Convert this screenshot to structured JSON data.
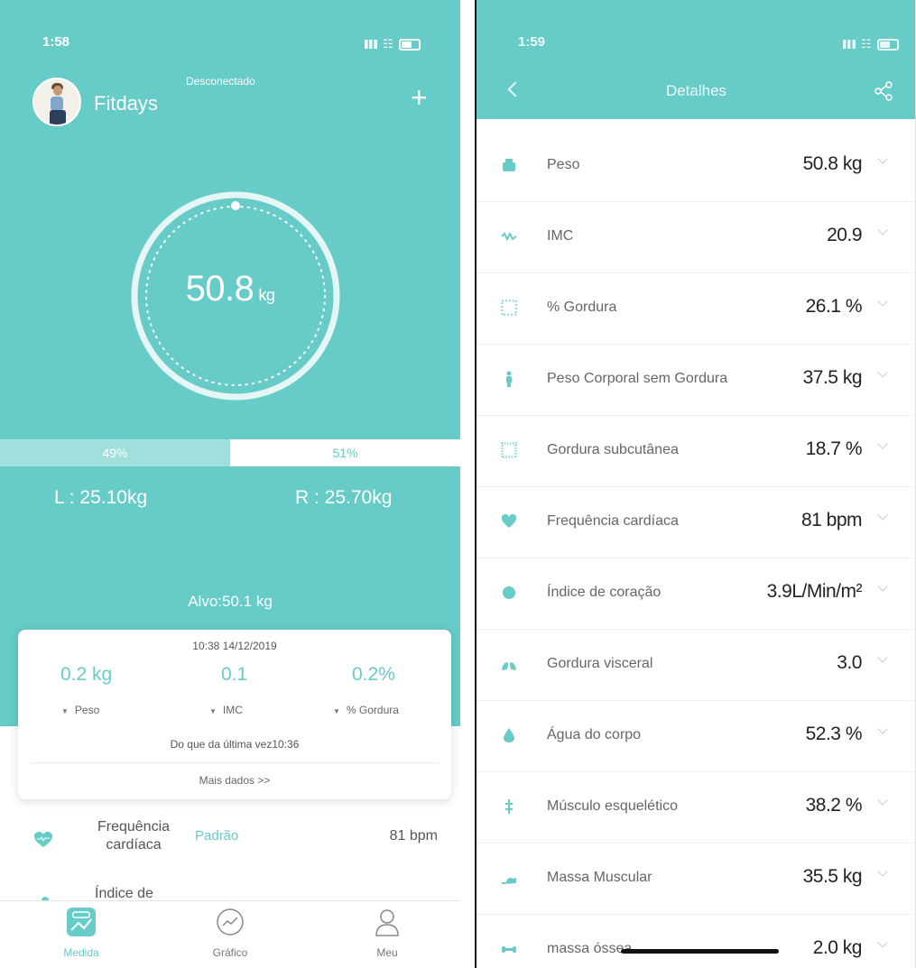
{
  "left": {
    "status_time": "1:58",
    "user_name": "Fitdays",
    "connection": "Desconectado",
    "add_symbol": "+",
    "weight_value": "50.8",
    "weight_unit": "kg",
    "balance": {
      "left_pct": "49%",
      "right_pct": "51%",
      "left_fraction": 0.49,
      "right_fraction": 0.51
    },
    "left_side": "L : 25.10kg",
    "right_side": "R : 25.70kg",
    "target": "Alvo:50.1 kg",
    "card": {
      "timestamp": "10:38 14/12/2019",
      "changes": [
        {
          "value": "0.2 kg",
          "label": "Peso"
        },
        {
          "value": "0.1",
          "label": "IMC"
        },
        {
          "value": "0.2%",
          "label": "% Gordura"
        }
      ],
      "since": "Do que da última vez10:36",
      "more": "Mais dados >>"
    },
    "metric_row": {
      "label_line1": "Frequência",
      "label_line2": "cardíaca",
      "standard": "Padrão",
      "value": "81 bpm"
    },
    "partial_row": {
      "label": "Índice de"
    },
    "tabs": [
      {
        "label": "Medida",
        "icon": "scale-icon"
      },
      {
        "label": "Gráfico",
        "icon": "chart-icon"
      },
      {
        "label": "Meu",
        "icon": "person-icon"
      }
    ]
  },
  "right": {
    "status_time": "1:59",
    "title": "Detalhes",
    "rows": [
      {
        "name": "Peso",
        "value": "50.8 kg",
        "icon": "scale-icon"
      },
      {
        "name": "IMC",
        "value": "20.9",
        "icon": "bmi-icon"
      },
      {
        "name": "% Gordura",
        "value": "26.1 %",
        "icon": "fat-icon"
      },
      {
        "name": "Peso Corporal sem Gordura",
        "value": "37.5 kg",
        "icon": "body-icon"
      },
      {
        "name": "Gordura subcutânea",
        "value": "18.7 %",
        "icon": "subcutaneous-icon"
      },
      {
        "name": "Frequência cardíaca",
        "value": "81 bpm",
        "icon": "heart-icon"
      },
      {
        "name": "Índice de coração",
        "value": "3.9L/Min/m²",
        "icon": "heart-index-icon"
      },
      {
        "name": "Gordura visceral",
        "value": "3.0",
        "icon": "lungs-icon"
      },
      {
        "name": "Água do corpo",
        "value": "52.3 %",
        "icon": "water-drop-icon"
      },
      {
        "name": "Músculo esquelético",
        "value": "38.2 %",
        "icon": "skeletal-muscle-icon"
      },
      {
        "name": "Massa Muscular",
        "value": "35.5 kg",
        "icon": "muscle-arm-icon"
      },
      {
        "name": "massa óssea",
        "value": "2.0 kg",
        "icon": "bone-icon"
      }
    ]
  },
  "colors": {
    "accent": "#67cbc8",
    "accent_light": "#a1dfdc"
  }
}
